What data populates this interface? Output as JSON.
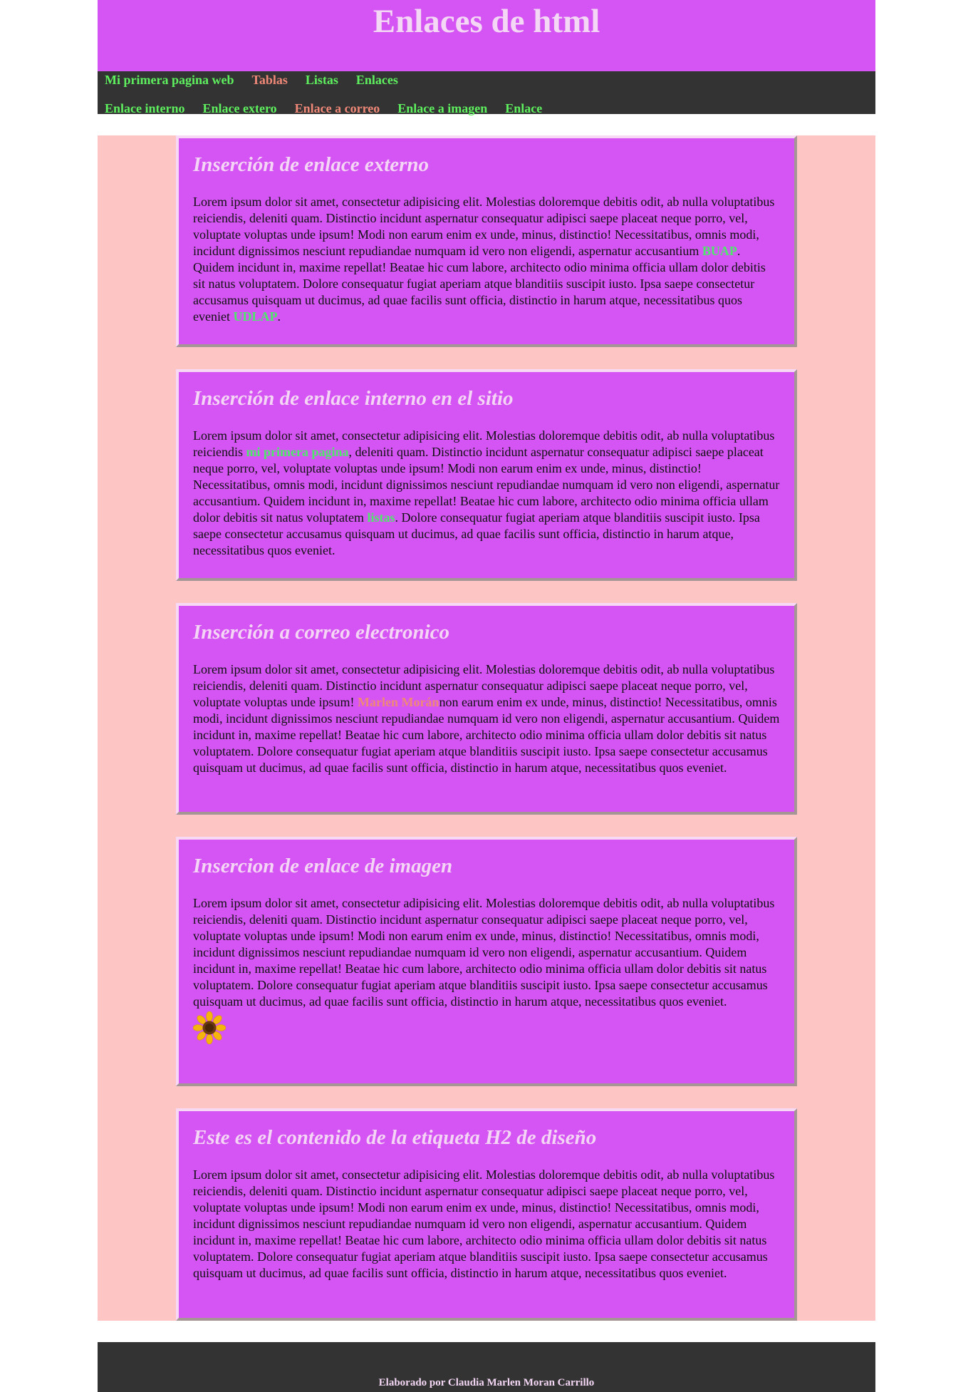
{
  "header": {
    "title": "Enlaces de html"
  },
  "nav": {
    "row1": [
      "Mi primera pagina web",
      "Tablas",
      "Listas",
      "Enlaces"
    ],
    "row2": [
      "Enlace interno",
      "Enlace extero",
      "Enlace a correo",
      "Enlace a imagen",
      "Enlace"
    ]
  },
  "colors": {
    "banner": "#d455f3",
    "nav_bg": "#333333",
    "content_bg": "#fdc5c3",
    "link_green": "#5ef05e",
    "link_salmon": "#f08878"
  },
  "sections": [
    {
      "title": "Inserción de enlace externo",
      "text1": "Lorem ipsum dolor sit amet, consectetur adipisicing elit. Molestias doloremque debitis odit, ab nulla voluptatibus reiciendis, deleniti quam. Distinctio incidunt aspernatur consequatur adipisci saepe placeat neque porro, vel, voluptate voluptas unde ipsum! Modi non earum enim ex unde, minus, distinctio! Necessitatibus, omnis modi, incidunt dignissimos nesciunt repudiandae numquam id vero non eligendi, aspernatur accusantium ",
      "link1": "BUAP",
      "text2": ". Quidem incidunt in, maxime repellat! Beatae hic cum labore, architecto odio minima officia ullam dolor debitis sit natus voluptatem. Dolore consequatur fugiat aperiam atque blanditiis suscipit iusto. Ipsa saepe consectetur accusamus quisquam ut ducimus, ad quae facilis sunt officia, distinctio in harum atque, necessitatibus quos eveniet ",
      "link2": "UDLAP",
      "text3": "."
    },
    {
      "title": "Inserción de enlace interno en el sitio",
      "text1": "Lorem ipsum dolor sit amet, consectetur adipisicing elit. Molestias doloremque debitis odit, ab nulla voluptatibus reiciendis ",
      "link1": "mi primera pagina",
      "text2": ", deleniti quam. Distinctio incidunt aspernatur consequatur adipisci saepe placeat neque porro, vel, voluptate voluptas unde ipsum! Modi non earum enim ex unde, minus, distinctio! Necessitatibus, omnis modi, incidunt dignissimos nesciunt repudiandae numquam id vero non eligendi, aspernatur accusantium. Quidem incidunt in, maxime repellat! Beatae hic cum labore, architecto odio minima officia ullam dolor debitis sit natus voluptatem ",
      "link2": "listas",
      "text3": ". Dolore consequatur fugiat aperiam atque blanditiis suscipit iusto. Ipsa saepe consectetur accusamus quisquam ut ducimus, ad quae facilis sunt officia, distinctio in harum atque, necessitatibus quos eveniet."
    },
    {
      "title": "Inserción a correo electronico",
      "text1": "Lorem ipsum dolor sit amet, consectetur adipisicing elit. Molestias doloremque debitis odit, ab nulla voluptatibus reiciendis, deleniti quam. Distinctio incidunt aspernatur consequatur adipisci saepe placeat neque porro, vel, voluptate voluptas unde ipsum! ",
      "link1": "Marlen Morán",
      "text2": "non earum enim ex unde, minus, distinctio! Necessitatibus, omnis modi, incidunt dignissimos nesciunt repudiandae numquam id vero non eligendi, aspernatur accusantium. Quidem incidunt in, maxime repellat! Beatae hic cum labore, architecto odio minima officia ullam dolor debitis sit natus voluptatem. Dolore consequatur fugiat aperiam atque blanditiis suscipit iusto. Ipsa saepe consectetur accusamus quisquam ut ducimus, ad quae facilis sunt officia, distinctio in harum atque, necessitatibus quos eveniet."
    },
    {
      "title": "Insercion de enlace de imagen",
      "text": "Lorem ipsum dolor sit amet, consectetur adipisicing elit. Molestias doloremque debitis odit, ab nulla voluptatibus reiciendis, deleniti quam. Distinctio incidunt aspernatur consequatur adipisci saepe placeat neque porro, vel, voluptate voluptas unde ipsum! Modi non earum enim ex unde, minus, distinctio! Necessitatibus, omnis modi, incidunt dignissimos nesciunt repudiandae numquam id vero non eligendi, aspernatur accusantium. Quidem incidunt in, maxime repellat! Beatae hic cum labore, architecto odio minima officia ullam dolor debitis sit natus voluptatem. Dolore consequatur fugiat aperiam atque blanditiis suscipit iusto. Ipsa saepe consectetur accusamus quisquam ut ducimus, ad quae facilis sunt officia, distinctio in harum atque, necessitatibus quos eveniet.",
      "image_icon": "sunflower-icon"
    },
    {
      "title": "Este es el contenido de la etiqueta H2 de diseño",
      "text": "Lorem ipsum dolor sit amet, consectetur adipisicing elit. Molestias doloremque debitis odit, ab nulla voluptatibus reiciendis, deleniti quam. Distinctio incidunt aspernatur consequatur adipisci saepe placeat neque porro, vel, voluptate voluptas unde ipsum! Modi non earum enim ex unde, minus, distinctio! Necessitatibus, omnis modi, incidunt dignissimos nesciunt repudiandae numquam id vero non eligendi, aspernatur accusantium. Quidem incidunt in, maxime repellat! Beatae hic cum labore, architecto odio minima officia ullam dolor debitis sit natus voluptatem. Dolore consequatur fugiat aperiam atque blanditiis suscipit iusto. Ipsa saepe consectetur accusamus quisquam ut ducimus, ad quae facilis sunt officia, distinctio in harum atque, necessitatibus quos eveniet."
    }
  ],
  "footer": {
    "text": "Elaborado por Claudia Marlen Moran Carrillo"
  }
}
